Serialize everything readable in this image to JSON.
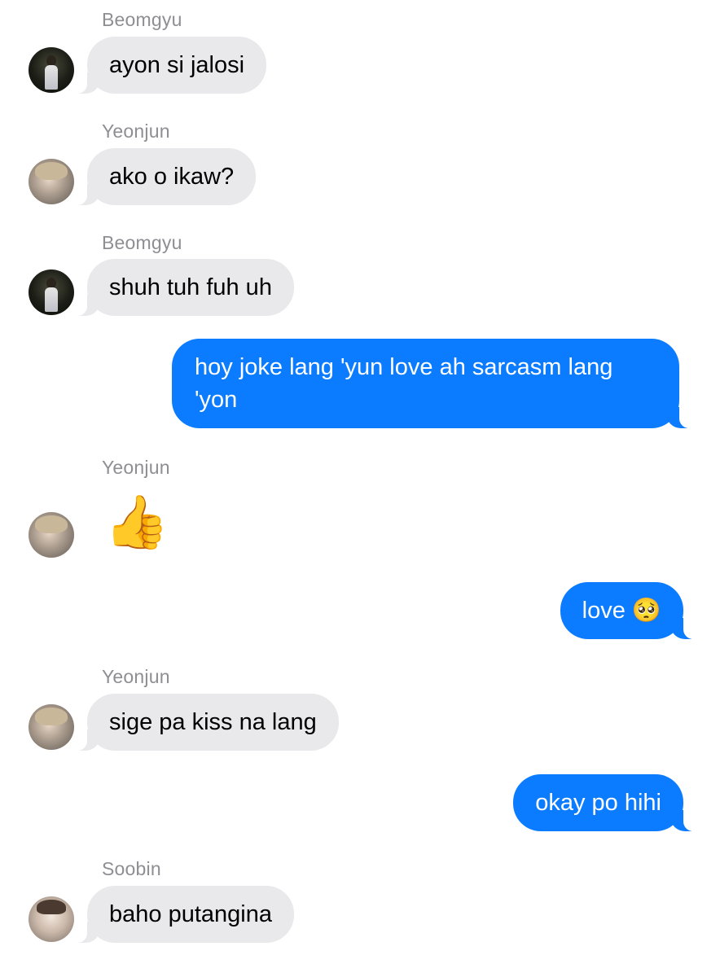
{
  "messages": [
    {
      "sender": "Beomgyu",
      "text": "ayon si jalosi"
    },
    {
      "sender": "Yeonjun",
      "text": "ako o ikaw?"
    },
    {
      "sender": "Beomgyu",
      "text": "shuh tuh fuh uh"
    },
    {
      "sender": "me",
      "text": "hoy joke lang 'yun love ah sarcasm lang 'yon"
    },
    {
      "sender": "Yeonjun",
      "text": "👍"
    },
    {
      "sender": "me",
      "text": "love 🥺"
    },
    {
      "sender": "Yeonjun",
      "text": "sige pa kiss na lang"
    },
    {
      "sender": "me",
      "text": "okay po hihi"
    },
    {
      "sender": "Soobin",
      "text": "baho putangina"
    }
  ],
  "colors": {
    "incoming_bubble": "#e9e9eb",
    "outgoing_bubble": "#0b7cff",
    "sender_label": "#8e8e93"
  }
}
